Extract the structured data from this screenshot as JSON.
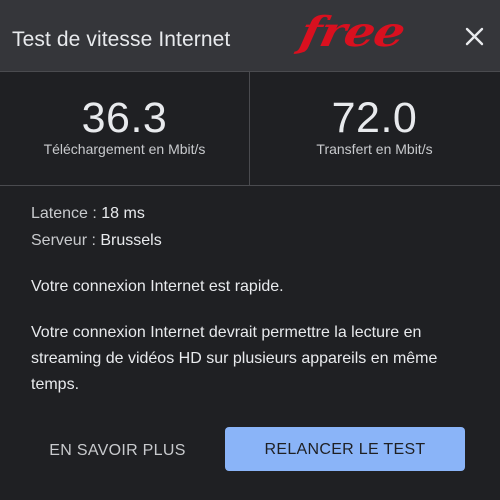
{
  "header": {
    "title": "Test de vitesse Internet",
    "logo_text": "free",
    "close_icon": "close-icon",
    "logo_color": "#d9101f"
  },
  "speeds": {
    "download": {
      "value": "36.3",
      "label": "Téléchargement en Mbit/s"
    },
    "upload": {
      "value": "72.0",
      "label": "Transfert en Mbit/s"
    }
  },
  "details": {
    "latency_label": "Latence : ",
    "latency_value": "18 ms",
    "server_label": "Serveur : ",
    "server_value": "Brussels"
  },
  "summary": "Votre connexion Internet est rapide.",
  "description": "Votre connexion Internet devrait permettre la lecture en streaming de vidéos HD sur plusieurs appareils en même temps.",
  "actions": {
    "learn_more": "EN SAVOIR PLUS",
    "rerun": "RELANCER LE TEST"
  },
  "colors": {
    "background": "#1f2023",
    "header": "#35363a",
    "primary_button": "#8ab4f8"
  }
}
